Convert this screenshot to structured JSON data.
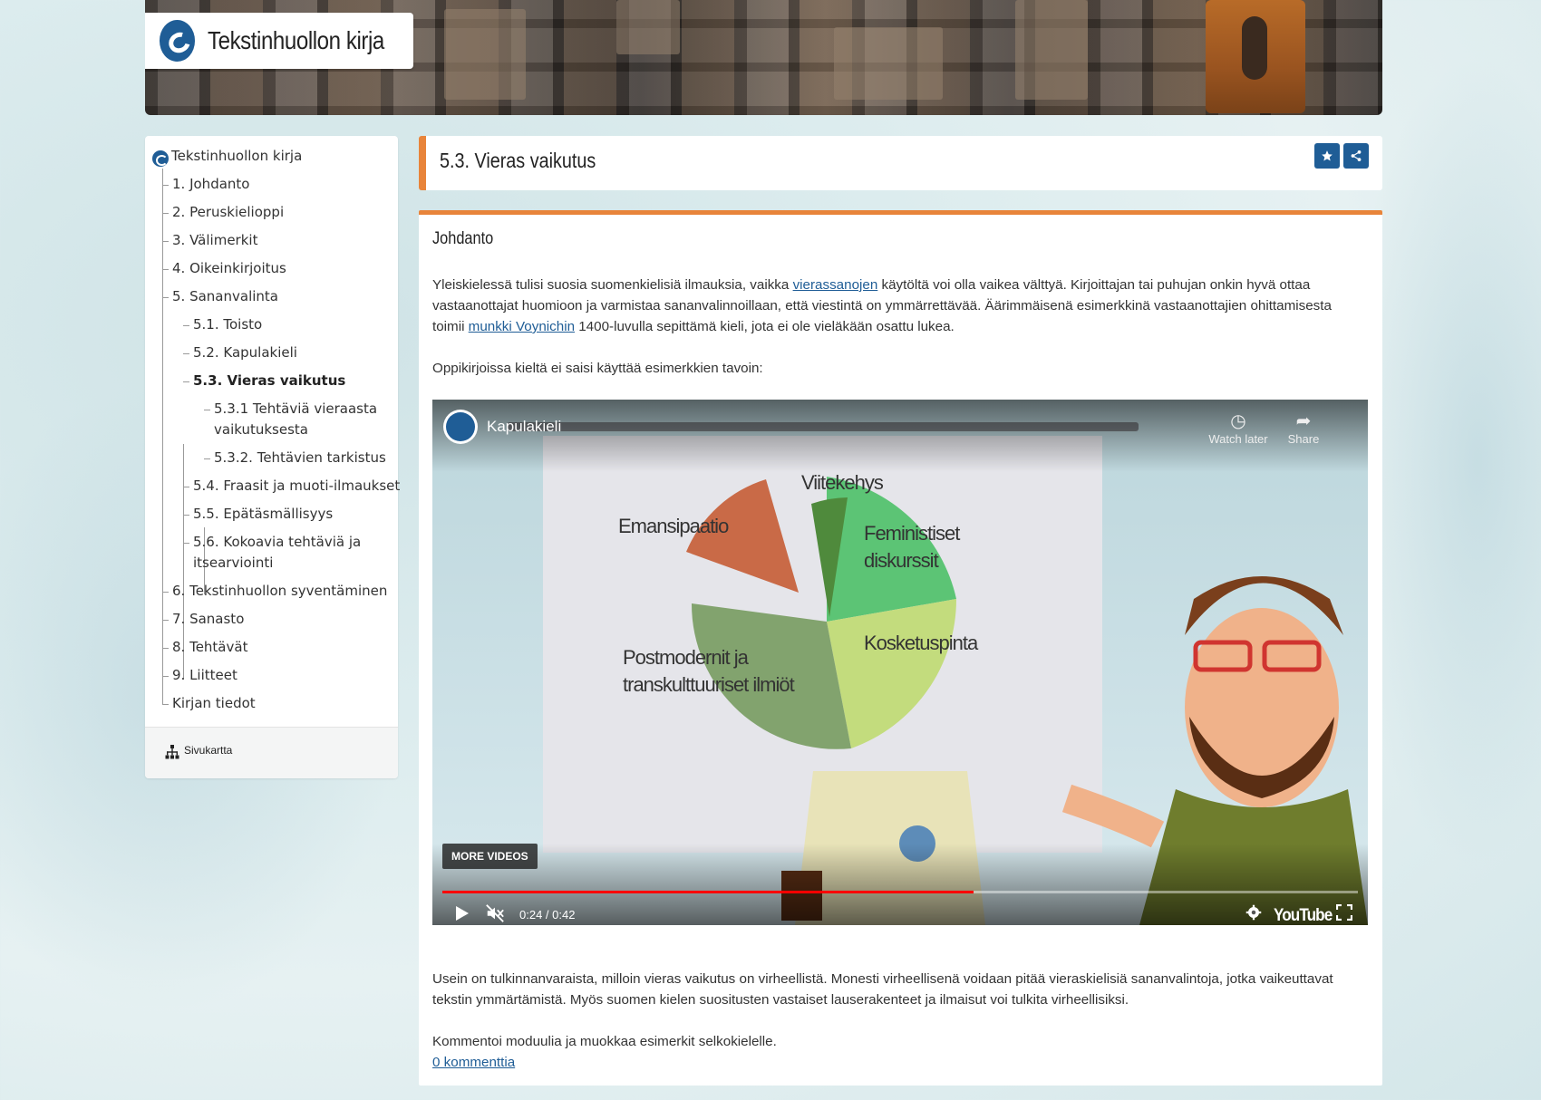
{
  "header": {
    "site_title": "Tekstinhuollon kirja"
  },
  "sidebar": {
    "root": "Tekstinhuollon kirja",
    "items": [
      {
        "label": "1. Johdanto"
      },
      {
        "label": "2. Peruskielioppi"
      },
      {
        "label": "3. Välimerkit"
      },
      {
        "label": "4. Oikeinkirjoitus"
      },
      {
        "label": "5. Sananvalinta"
      },
      {
        "label": "5.1. Toisto"
      },
      {
        "label": "5.2. Kapulakieli"
      },
      {
        "label": "5.3. Vieras vaikutus"
      },
      {
        "label": "5.3.1 Tehtäviä vieraasta vaikutuksesta"
      },
      {
        "label": "5.3.2. Tehtävien tarkistus"
      },
      {
        "label": "5.4. Fraasit ja muoti-ilmaukset"
      },
      {
        "label": "5.5. Epätäsmällisyys"
      },
      {
        "label": "5.6. Kokoavia tehtäviä ja itsearviointi"
      },
      {
        "label": "6. Tekstinhuollon syventäminen"
      },
      {
        "label": "7. Sanasto"
      },
      {
        "label": "8. Tehtävät"
      },
      {
        "label": "9. Liitteet"
      },
      {
        "label": "Kirjan tiedot"
      }
    ],
    "sitemap_label": "Sivukartta"
  },
  "page": {
    "title": "5.3. Vieras vaikutus",
    "section_title": "Johdanto",
    "p1_before": "Yleiskielessä tulisi suosia suomenkielisiä ilmauksia, vaikka ",
    "p1_link1": "vierassanojen",
    "p1_mid": " käytöltä voi olla vaikea välttyä. Kirjoittajan tai puhujan onkin hyvä ottaa vastaanottajat huomioon ja varmistaa sananvalinnoillaan, että viestintä on ymmärrettävää. Äärimmäisenä esimerkkinä vastaanottajien ohittamisesta toimii ",
    "p1_link2": "munkki Voynichin",
    "p1_after": " 1400-luvulla sepittämä kieli, jota ei ole vieläkään osattu lukea.",
    "p2": "Oppikirjoissa kieltä ei saisi käyttää esimerkkien tavoin:",
    "p3": "Usein on tulkinnanvaraista, milloin vieras vaikutus on virheellistä. Monesti virheellisenä voidaan pitää vieraskielisiä sananvalintoja, jotka vaikeuttavat tekstin ymmärtämistä. Myös suomen kielen suositusten vastaiset lauserakenteet ja ilmaisut voi tulkita virheellisiksi.",
    "p4": "Kommentoi moduulia ja muokkaa esimerkit selkokielelle.",
    "comments_link": "0 kommenttia"
  },
  "video": {
    "title": "Kapulakieli",
    "watch_later": "Watch later",
    "share": "Share",
    "more_videos": "MORE VIDEOS",
    "time_current": "0:24",
    "time_total": "0:42",
    "progress_fraction": 0.58,
    "brand": "YouTube",
    "pie_labels": {
      "a": "Viitekehys",
      "b": "Emansipaatio",
      "c1": "Feministiset",
      "c2": "diskurssit",
      "d": "Kosketuspinta",
      "e1": "Postmodernit ja",
      "e2": "transkulttuuriset ilmiöt"
    }
  },
  "colors": {
    "accent": "#e8843a",
    "brand_blue": "#1f5d96",
    "link": "#1f5d96"
  }
}
